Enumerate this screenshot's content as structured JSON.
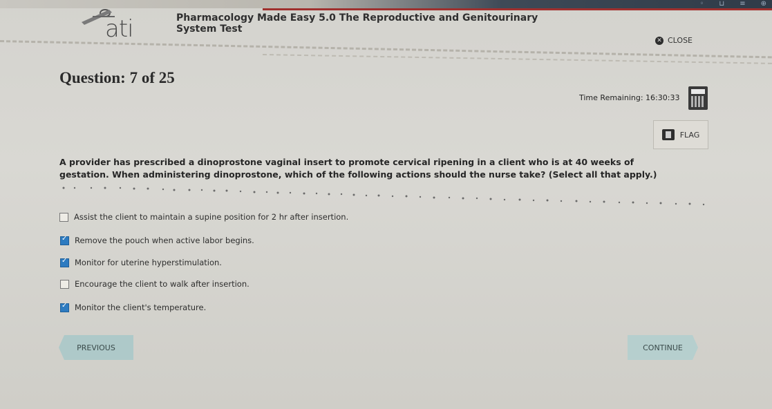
{
  "header": {
    "logo_text": "ati",
    "title": "Pharmacology Made Easy 5.0 The Reproductive and Genitourinary",
    "subtitle": "System Test",
    "close_label": "CLOSE"
  },
  "question_header": {
    "label": "Question: 7 of 25",
    "current": 7,
    "total": 25
  },
  "timer": {
    "label": "Time Remaining:",
    "value": "16:30:33"
  },
  "flag": {
    "label": "FLAG"
  },
  "question": {
    "text": "A provider has prescribed a dinoprostone vaginal insert to promote cervical ripening in a client who is at 40 weeks of gestation. When administering dinoprostone, which of the following actions should the nurse take? (Select all that apply.)"
  },
  "options": [
    {
      "label": "Assist the client to maintain a supine position for 2 hr after insertion.",
      "checked": false
    },
    {
      "label": "Remove the pouch when active labor begins.",
      "checked": true
    },
    {
      "label": "Monitor for uterine hyperstimulation.",
      "checked": true
    },
    {
      "label": "Encourage the client to walk after insertion.",
      "checked": false
    },
    {
      "label": "Monitor the client's temperature.",
      "checked": true
    }
  ],
  "nav": {
    "previous_label": "PREVIOUS",
    "continue_label": "CONTINUE"
  },
  "colors": {
    "checkbox_checked": "#2d7bc0",
    "nav_button": "#aec9c9",
    "accent_line": "#a0302e"
  }
}
